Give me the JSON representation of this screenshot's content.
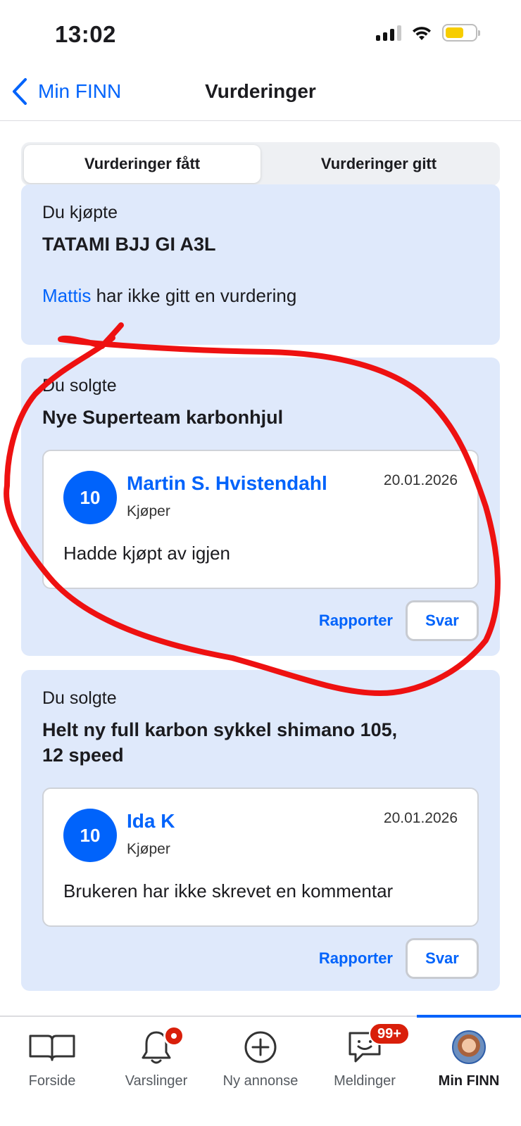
{
  "status_bar": {
    "time": "13:02"
  },
  "header": {
    "back_label": "Min FINN",
    "title": "Vurderinger"
  },
  "tabs": [
    {
      "label": "Vurderinger fått",
      "active": true
    },
    {
      "label": "Vurderinger gitt",
      "active": false
    }
  ],
  "cards": [
    {
      "kind": "Du kjøpte",
      "title": "TATAMI BJJ GI A3L",
      "counterparty": "Mattis",
      "no_review_text": " har ikke gitt en vurdering"
    },
    {
      "kind": "Du solgte",
      "title": "Nye Superteam karbonhjul",
      "review": {
        "score": "10",
        "reviewer": "Martin S. Hvistendahl",
        "role": "Kjøper",
        "date": "20.01.2026",
        "comment": "Hadde kjøpt av igjen"
      },
      "report_label": "Rapporter",
      "reply_label": "Svar"
    },
    {
      "kind": "Du solgte",
      "title_line1": "Helt ny full karbon sykkel shimano 105,",
      "title_line2": "12 speed",
      "review": {
        "score": "10",
        "reviewer": "Ida K",
        "role": "Kjøper",
        "date": "20.01.2026",
        "comment": "Brukeren har ikke skrevet en kommentar"
      },
      "report_label": "Rapporter",
      "reply_label": "Svar"
    }
  ],
  "tabbar": {
    "items": [
      {
        "label": "Forside",
        "icon": "book-icon"
      },
      {
        "label": "Varslinger",
        "icon": "bell-icon"
      },
      {
        "label": "Ny annonse",
        "icon": "plus-circle-icon"
      },
      {
        "label": "Meldinger",
        "icon": "chat-icon",
        "badge": "99+"
      },
      {
        "label": "Min FINN",
        "icon": "avatar",
        "active": true
      }
    ]
  },
  "colors": {
    "accent": "#0063fb",
    "card_bg": "#dfe9fb",
    "badge": "#d91f0a",
    "annotation": "#ee1111"
  }
}
